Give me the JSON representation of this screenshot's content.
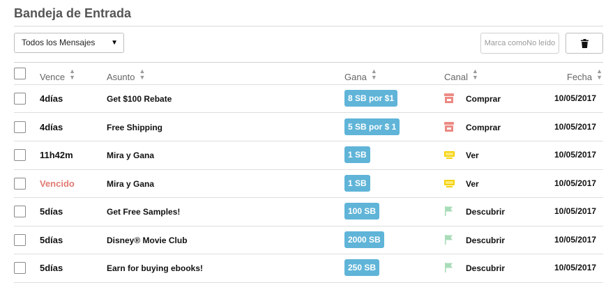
{
  "inbox": {
    "title": "Bandeja de Entrada",
    "filter_value": "Todos los Mensajes",
    "mark_unread_label": "Marca comoNo leído",
    "delete_icon": "trash-icon"
  },
  "columns": {
    "due": "Vence",
    "subject": "Asunto",
    "earn": "Gana",
    "channel": "Canal",
    "date": "Fecha"
  },
  "colors": {
    "badge": "#5fb4d8",
    "expired": "#e07a72",
    "shop_icon": "#ec8a83",
    "watch_icon": "#f5d20a",
    "discover_icon": "#a8dcb8"
  },
  "rows": [
    {
      "due": "4días",
      "expired": false,
      "subject": "Get $100 Rebate",
      "earn": "8 SB por $1",
      "channel": "Comprar",
      "channel_icon": "store-icon",
      "date": "10/05/2017"
    },
    {
      "due": "4días",
      "expired": false,
      "subject": "Free Shipping",
      "earn": "5 SB por $ 1",
      "channel": "Comprar",
      "channel_icon": "store-icon",
      "date": "10/05/2017"
    },
    {
      "due": "11h42m",
      "expired": false,
      "subject": "Mira y Gana",
      "earn": "1 SB",
      "channel": "Ver",
      "channel_icon": "video-icon",
      "date": "10/05/2017"
    },
    {
      "due": "Vencido",
      "expired": true,
      "subject": "Mira y Gana",
      "earn": "1 SB",
      "channel": "Ver",
      "channel_icon": "video-icon",
      "date": "10/05/2017"
    },
    {
      "due": "5días",
      "expired": false,
      "subject": "Get Free Samples!",
      "earn": "100 SB",
      "channel": "Descubrir",
      "channel_icon": "flag-icon",
      "date": "10/05/2017"
    },
    {
      "due": "5días",
      "expired": false,
      "subject": "Disney® Movie Club",
      "earn": "2000 SB",
      "channel": "Descubrir",
      "channel_icon": "flag-icon",
      "date": "10/05/2017"
    },
    {
      "due": "5días",
      "expired": false,
      "subject": "Earn for buying ebooks!",
      "earn": "250 SB",
      "channel": "Descubrir",
      "channel_icon": "flag-icon",
      "date": "10/05/2017"
    }
  ]
}
